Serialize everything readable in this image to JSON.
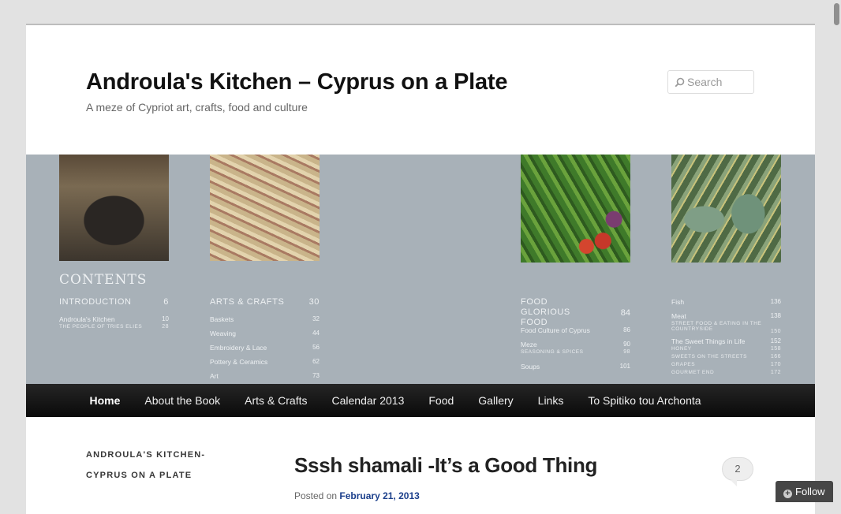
{
  "site": {
    "title": "Androula's Kitchen – Cyprus on a Plate",
    "description": "A meze of Cypriot art, crafts, food and culture"
  },
  "search": {
    "placeholder": "Search"
  },
  "header_image": {
    "contents_title": "CONTENTS",
    "sections": [
      {
        "heading": "INTRODUCTION",
        "page": "6",
        "rows": [
          {
            "label": "Androula's Kitchen",
            "page": "10"
          }
        ],
        "subs": [
          {
            "label": "THE PEOPLE OF TRIES ELIES",
            "page": "28"
          }
        ]
      },
      {
        "heading": "ARTS & CRAFTS",
        "page": "30",
        "rows": [
          {
            "label": "Baskets",
            "page": "32"
          },
          {
            "label": "Weaving",
            "page": "44"
          },
          {
            "label": "Embroidery & Lace",
            "page": "56"
          },
          {
            "label": "Pottery & Ceramics",
            "page": "62"
          },
          {
            "label": "Art",
            "page": "73"
          }
        ]
      },
      {
        "heading": "FOOD GLORIOUS FOOD",
        "page": "84",
        "rows": [
          {
            "label": "Food Culture of Cyprus",
            "page": "86"
          },
          {
            "label": "Meze",
            "page": "90"
          },
          {
            "label": "Soups",
            "page": "101"
          }
        ],
        "subs": [
          {
            "label": "SEASONING & SPICES",
            "page": "98"
          }
        ]
      },
      {
        "rows": [
          {
            "label": "Fish",
            "page": "136"
          },
          {
            "label": "Meat",
            "page": "138"
          },
          {
            "label": "The Sweet Things in Life",
            "page": "152"
          }
        ],
        "subs": [
          {
            "label": "STREET FOOD & EATING IN THE COUNTRYSIDE",
            "page": "150"
          },
          {
            "label": "HONEY",
            "page": "158"
          },
          {
            "label": "SWEETS ON THE STREETS",
            "page": "166"
          },
          {
            "label": "GRAPES",
            "page": "170"
          },
          {
            "label": "GOURMET END",
            "page": "172"
          }
        ]
      }
    ]
  },
  "nav": {
    "items": [
      "Home",
      "About the Book",
      "Arts & Crafts",
      "Calendar 2013",
      "Food",
      "Gallery",
      "Links",
      "To Spitiko tou Archonta"
    ],
    "active": "Home"
  },
  "sidebar": {
    "widget_title": "ANDROULA'S KITCHEN-CYPRUS ON A PLATE"
  },
  "post": {
    "title": "Sssh shamali -It’s a Good Thing",
    "comment_count": "2",
    "posted_on_label": "Posted on",
    "date": "February 21, 2013"
  },
  "follow": {
    "label": "Follow"
  }
}
